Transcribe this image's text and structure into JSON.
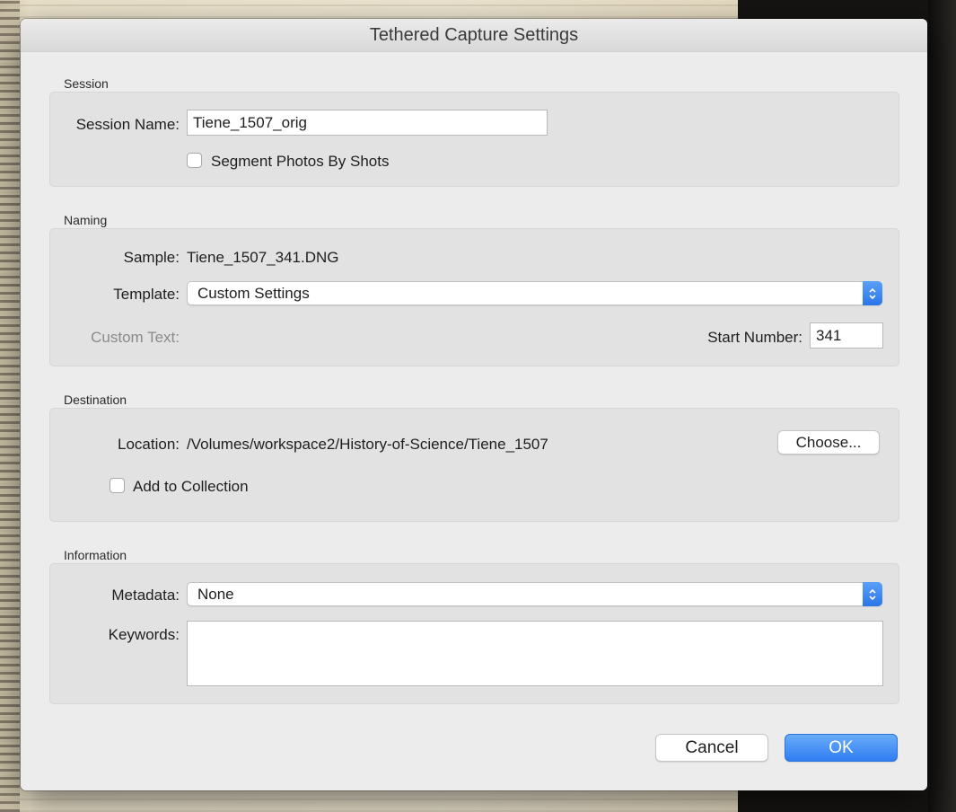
{
  "window": {
    "title": "Tethered Capture Settings"
  },
  "session": {
    "section_title": "Session",
    "name_label": "Session Name:",
    "name_value": "Tiene_1507_orig",
    "segment_label": "Segment Photos By Shots",
    "segment_checked": false
  },
  "naming": {
    "section_title": "Naming",
    "sample_label": "Sample:",
    "sample_value": "Tiene_1507_341.DNG",
    "template_label": "Template:",
    "template_value": "Custom Settings",
    "custom_text_label": "Custom Text:",
    "start_number_label": "Start Number:",
    "start_number_value": "341"
  },
  "destination": {
    "section_title": "Destination",
    "location_label": "Location:",
    "location_value": "/Volumes/workspace2/History-of-Science/Tiene_1507",
    "choose_label": "Choose...",
    "add_collection_label": "Add to Collection",
    "add_collection_checked": false
  },
  "information": {
    "section_title": "Information",
    "metadata_label": "Metadata:",
    "metadata_value": "None",
    "keywords_label": "Keywords:",
    "keywords_value": ""
  },
  "footer": {
    "cancel_label": "Cancel",
    "ok_label": "OK"
  },
  "colors": {
    "accent": "#2f7df0",
    "dialog_bg": "#ececec",
    "group_bg": "#e2e2e2"
  }
}
